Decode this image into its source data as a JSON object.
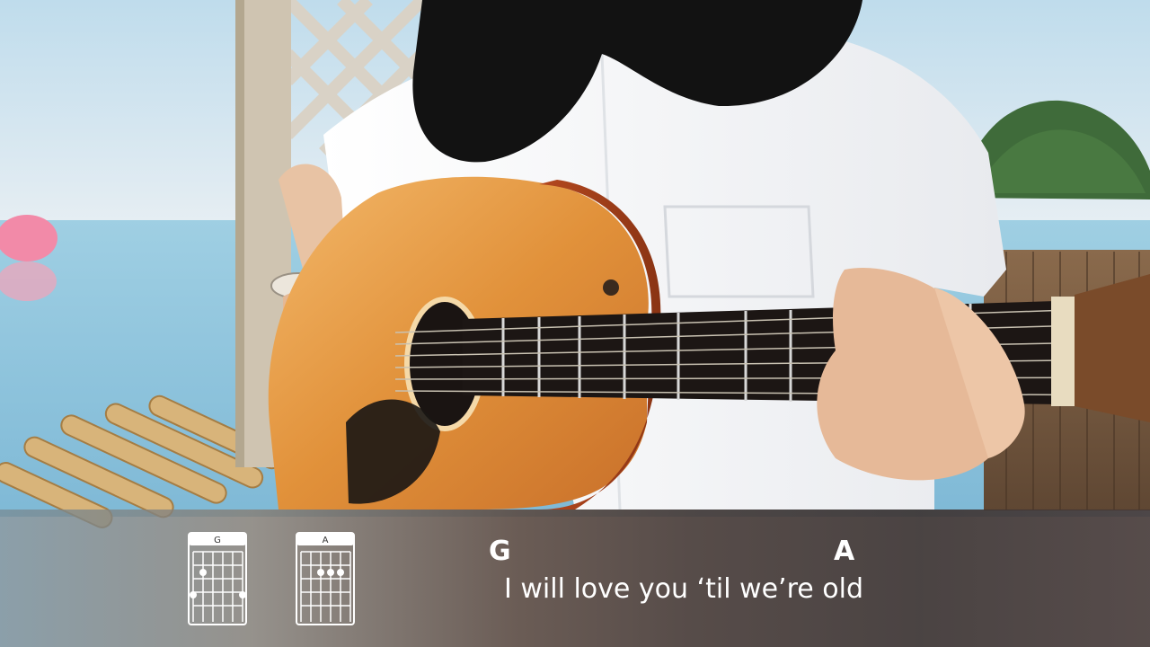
{
  "video_frame": {
    "description_icon": "guitar-cover-scene"
  },
  "chord_diagrams": [
    {
      "name": "G"
    },
    {
      "name": "A"
    }
  ],
  "lyrics": {
    "chord_1": "G",
    "chord_2": "A",
    "line": "I will love you ‘til we’re old"
  },
  "colors": {
    "sky": "#cfe4ef",
    "sea": "#8fc6de",
    "shirt": "#f2f3f5",
    "guitar_top": "#e59a45",
    "fretboard": "#1c1614",
    "overlay_text": "#ffffff"
  }
}
